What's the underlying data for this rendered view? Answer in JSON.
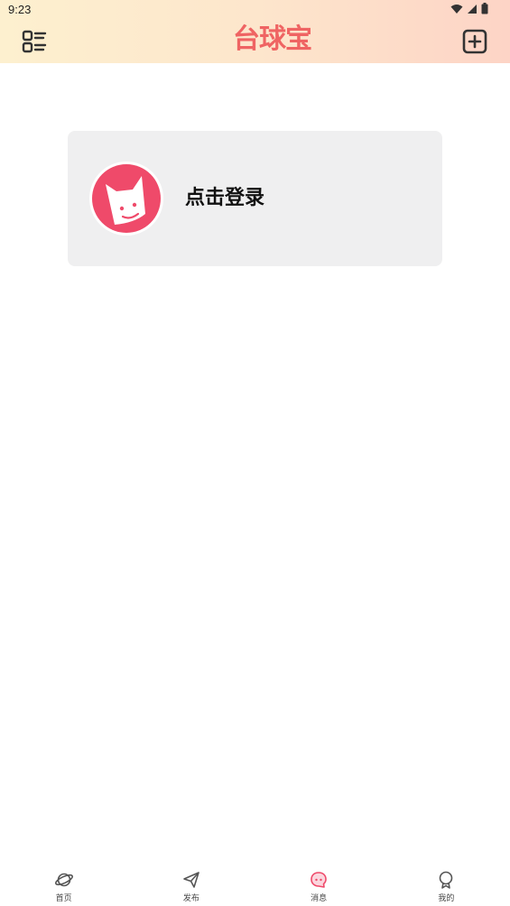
{
  "status_bar": {
    "time": "9:23"
  },
  "header": {
    "logo_text": "台球宝",
    "icons": [
      "menu-list-icon",
      "add-square-icon"
    ]
  },
  "login_card": {
    "label": "点击登录"
  },
  "tabbar": {
    "items": [
      {
        "label": "首页",
        "icon": "planet-icon",
        "active": false
      },
      {
        "label": "发布",
        "icon": "paper-plane-icon",
        "active": false
      },
      {
        "label": "消息",
        "icon": "chat-bubble-icon",
        "active": true
      },
      {
        "label": "我的",
        "icon": "profile-icon",
        "active": false
      }
    ]
  },
  "colors": {
    "accent": "#ef4a6a",
    "logo": "#ef6463",
    "card_bg": "#efeff0",
    "header_gradient_start": "#fdf0cf",
    "header_gradient_end": "#fdd4c6"
  }
}
